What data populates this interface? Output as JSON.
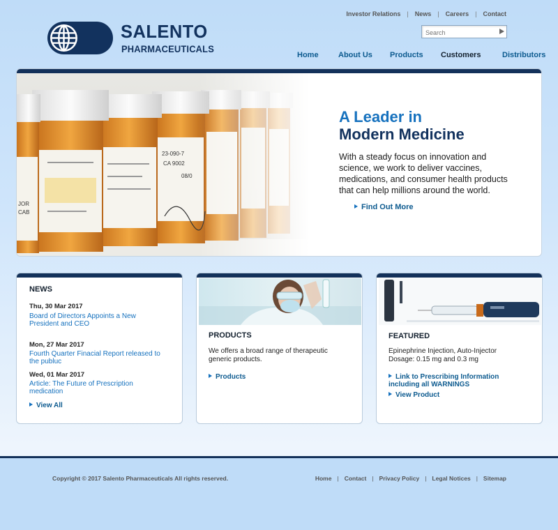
{
  "top_links": [
    "Investor Relations",
    "News",
    "Careers",
    "Contact"
  ],
  "search": {
    "placeholder": "Search"
  },
  "logo": {
    "line1": "SALENTO",
    "line2": "PHARMACEUTICALS"
  },
  "nav": [
    "Home",
    "About Us",
    "Products",
    "Customers",
    "Distributors"
  ],
  "hero": {
    "title_line1": "A Leader in",
    "title_line2": "Modern Medicine",
    "body": "With a steady focus on innovation and science, we work to deliver vaccines, medications, and consumer health products that can help millions around the world.",
    "cta": "Find Out More"
  },
  "news": {
    "heading": "NEWS",
    "items": [
      {
        "date": "Thu, 30 Mar 2017",
        "title": "Board of Directors Appoints a New President and CEO"
      },
      {
        "date": "Mon, 27 Mar 2017",
        "title": "Fourth Quarter Finacial Report released to the publuc"
      },
      {
        "date": "Wed, 01 Mar 2017",
        "title": "Article: The Future of Prescription medication"
      }
    ],
    "view_all": "View All"
  },
  "products": {
    "heading": "PRODUCTS",
    "text": "We offers a broad range of therapeutic generic products.",
    "link": "Products"
  },
  "featured": {
    "heading": "FEATURED",
    "line1": "Epinephrine Injection, Auto-Injector",
    "line2": "Dosage: 0.15 mg and 0.3 mg",
    "link1": "Link to Prescribing Information including all WARNINGS",
    "link2": "View Product"
  },
  "footer": {
    "copyright": "Copyright © 2017 Salento Pharmaceuticals All rights reserved.",
    "links": [
      "Home",
      "Contact",
      "Privacy Policy",
      "Legal Notices",
      "Sitemap"
    ]
  },
  "colors": {
    "navy": "#12325e",
    "accent_blue": "#1571be",
    "link_blue": "#0c5a8f",
    "page_bg": "#bfdcf8"
  }
}
